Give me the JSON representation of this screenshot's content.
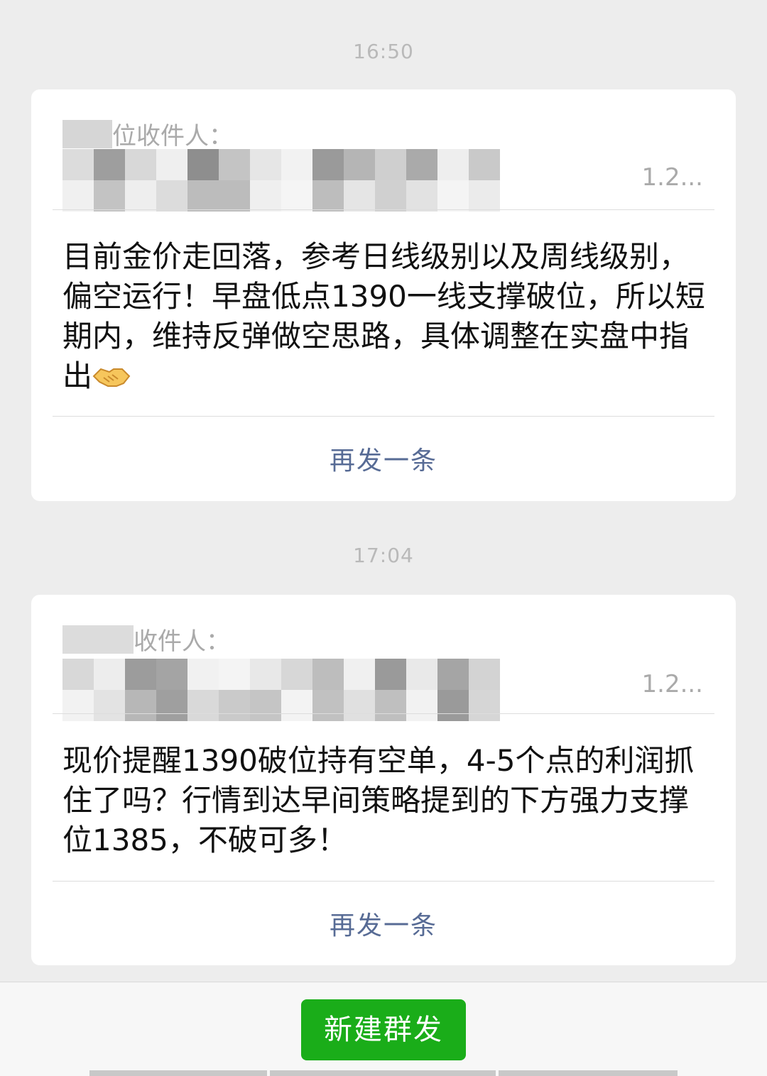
{
  "messages": [
    {
      "time": "16:50",
      "recipient_label": "位收件人：",
      "recipients_tail": "1.2...",
      "text": "目前金价走回落，参考日线级别以及周线级别，偏空运行！早盘低点1390一线支撑破位，所以短期内，维持反弹做空思路，具体调整在实盘中指出",
      "emoji": "handshake",
      "resend_label": "再发一条"
    },
    {
      "time": "17:04",
      "recipient_label": "收件人：",
      "recipients_tail": "1.2...",
      "text": "现价提醒1390破位持有空单，4-5个点的利润抓住了吗？行情到达早间策略提到的下方强力支撑位1385，不破可多！",
      "resend_label": "再发一条"
    }
  ],
  "bottom_bar": {
    "new_mass_send_label": "新建群发"
  },
  "colors": {
    "background": "#ededed",
    "card": "#ffffff",
    "link": "#576b95",
    "primary_button": "#1aad19",
    "timestamp": "#b9b9b9"
  }
}
